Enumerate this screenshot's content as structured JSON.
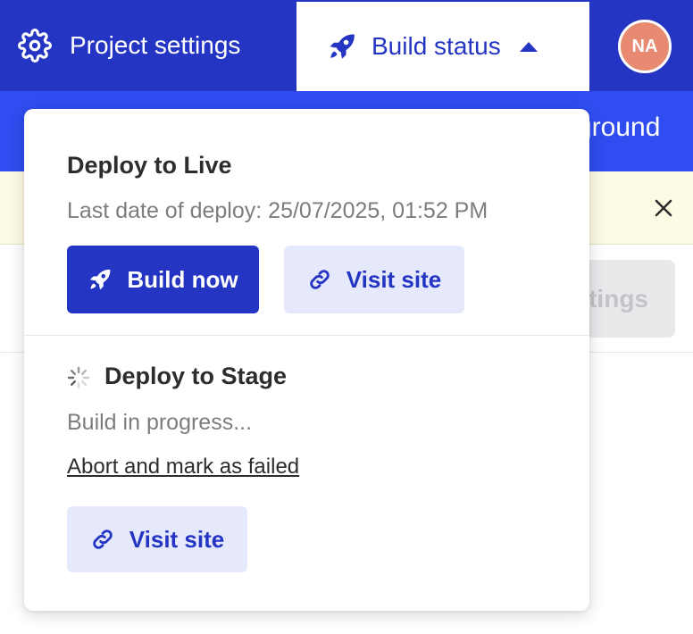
{
  "header": {
    "project_settings_label": "Project settings",
    "build_status_label": "Build status",
    "avatar_initials": "NA"
  },
  "subbar": {
    "partial_text": "ground"
  },
  "background": {
    "partial_button_label": "ttings"
  },
  "dropdown": {
    "live": {
      "title": "Deploy to Live",
      "last_deploy": "Last date of deploy: 25/07/2025, 01:52 PM",
      "build_button": "Build now",
      "visit_button": "Visit site"
    },
    "stage": {
      "title": "Deploy to Stage",
      "status": "Build in progress...",
      "abort_link": "Abort and mark as failed",
      "visit_button": "Visit site"
    }
  },
  "icons": {
    "project_settings": "gear-icon",
    "build_status": "rocket-icon",
    "caret": "caret-up-icon",
    "build_now": "rocket-icon",
    "visit_site": "link-icon",
    "stage_status": "spinner-icon",
    "banner_close": "close-icon"
  },
  "colors": {
    "primary": "#2435c3",
    "subbar": "#2f4df0",
    "secondary_button_bg": "#e6e9fb",
    "avatar_bg": "#e88a72",
    "banner_bg": "#fdfbe3"
  }
}
